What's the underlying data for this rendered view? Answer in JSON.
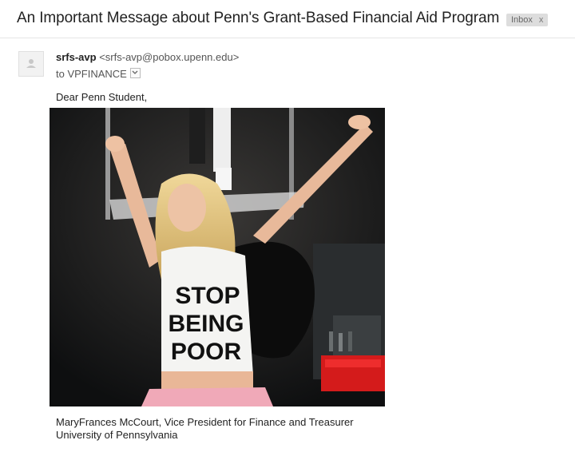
{
  "email": {
    "subject": "An Important Message about Penn's Grant-Based Financial Aid Program",
    "label": "Inbox",
    "label_close": "x",
    "sender_name": "srfs-avp",
    "sender_email": "<srfs-avp@pobox.upenn.edu>",
    "recipient": "to VPFINANCE",
    "greeting": "Dear Penn Student,",
    "photo": {
      "shirt_text": [
        "STOP",
        "BEING",
        "POOR"
      ]
    },
    "signature": {
      "line1": "MaryFrances McCourt, Vice President for Finance and Treasurer",
      "line2": "University of Pennsylvania"
    }
  }
}
